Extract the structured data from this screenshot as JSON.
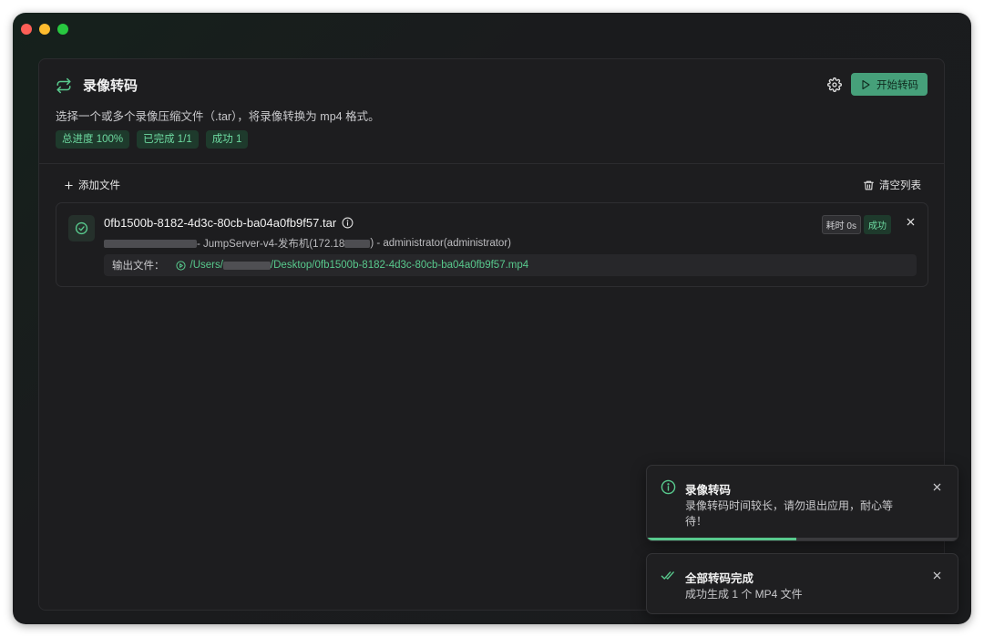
{
  "app": {
    "title": "录像转码",
    "description": "选择一个或多个录像压缩文件（.tar），将录像转换为 mp4 格式。",
    "start_button": "开始转码",
    "badges": [
      "总进度 100%",
      "已完成 1/1",
      "成功 1"
    ]
  },
  "toolbar": {
    "add_file": "添加文件",
    "clear_list": "清空列表"
  },
  "files": [
    {
      "name": "0fb1500b-8182-4d3c-80cb-ba04a0fb9f57.tar",
      "meta_mid": "- JumpServer-v4-发布机(172.18",
      "meta_end": ") - administrator(administrator)",
      "time_badge": "耗时 0s",
      "status": "成功",
      "output_label": "输出文件：",
      "output_prefix": "/Users/",
      "output_suffix": "/Desktop/0fb1500b-8182-4d3c-80cb-ba04a0fb9f57.mp4"
    }
  ],
  "toasts": [
    {
      "title": "录像转码",
      "text": "录像转码时间较长，请勿退出应用，耐心等待！",
      "progress": 0.48
    },
    {
      "title": "全部转码完成",
      "text": "成功生成 1 个 MP4 文件"
    }
  ],
  "colors": {
    "accent": "#58c98d",
    "button_bg": "#46a07a",
    "badge_bg": "#1e3a2c"
  }
}
